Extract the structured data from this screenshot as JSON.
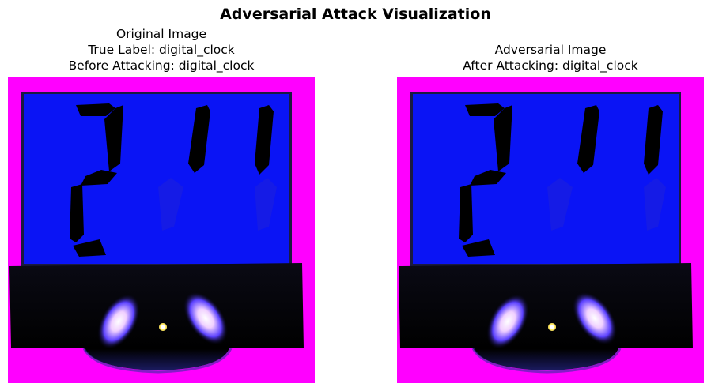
{
  "figure": {
    "suptitle": "Adversarial Attack Visualization"
  },
  "panels": {
    "original": {
      "title_line1": "Original Image",
      "title_line2": "True Label: digital_clock",
      "title_line3": "Before Attacking: digital_clock"
    },
    "adversarial": {
      "title_line1": "Adversarial Image",
      "title_line2": "After Attacking: digital_clock"
    }
  },
  "image_content": {
    "subject": "digital clock",
    "display_digits": "2 1 1",
    "colors": {
      "background": "#ff00ff",
      "screen": "#0a14f5",
      "body": "#000000",
      "glow": "#f0d0ff"
    }
  }
}
